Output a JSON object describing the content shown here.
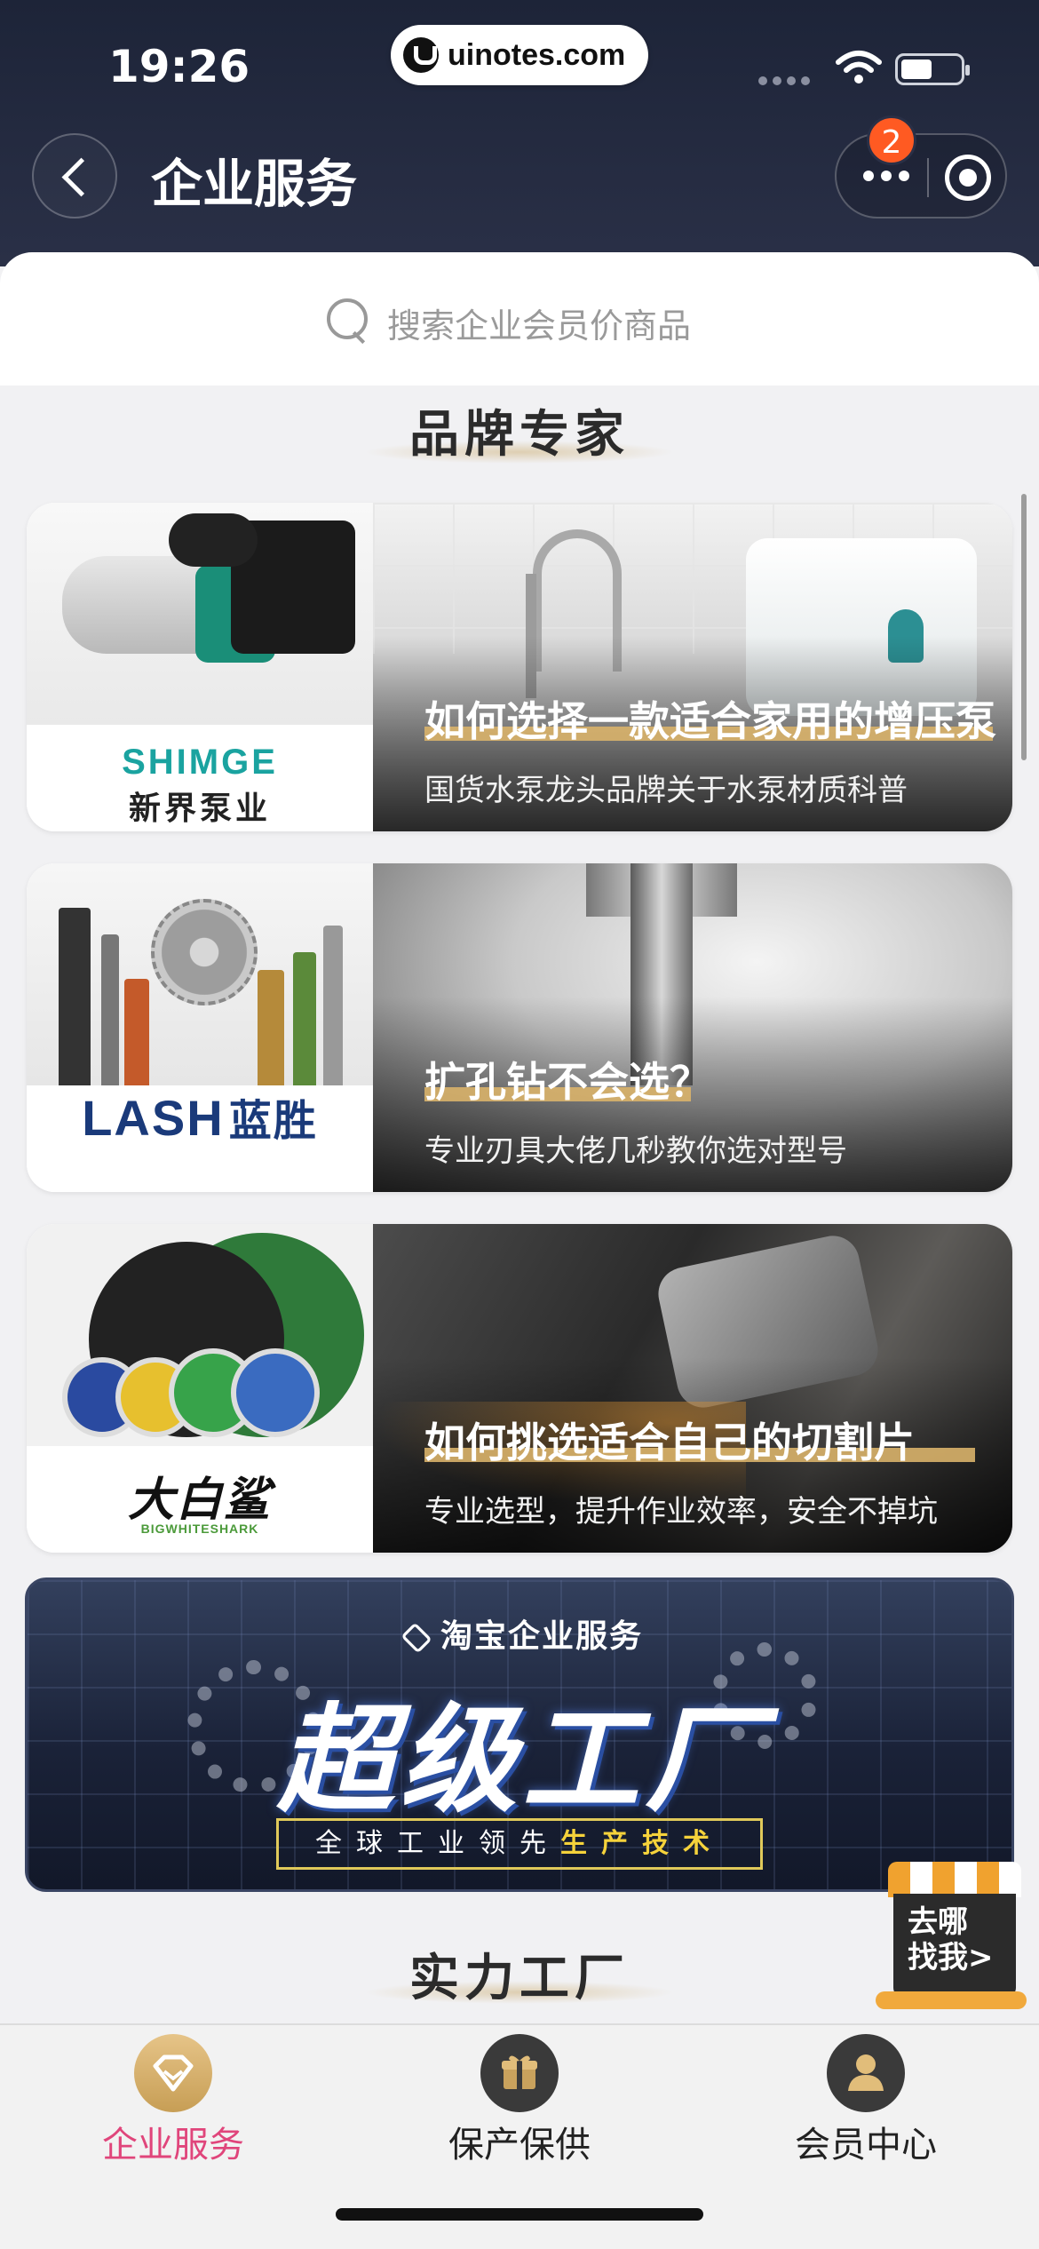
{
  "status_bar": {
    "time": "19:26",
    "watermark": "uinotes.com"
  },
  "nav": {
    "title": "企业服务",
    "badge_count": "2"
  },
  "search": {
    "placeholder": "搜索企业会员价商品"
  },
  "sections": {
    "brand_experts": "品牌专家",
    "strong_factory": "实力工厂"
  },
  "brand_cards": [
    {
      "brand_en": "SHIMGE",
      "brand_cn": "新界泵业",
      "title": "如何选择一款适合家用的增压泵",
      "subtitle": "国货水泵龙头品牌关于水泵材质科普"
    },
    {
      "brand_en": "LASH",
      "brand_cn": "蓝胜",
      "title": "扩孔钻不会选？",
      "subtitle": "专业刃具大佬几秒教你选对型号"
    },
    {
      "brand_cn": "大白鲨",
      "brand_en": "BIGWHITESHARK",
      "title": "如何挑选适合自己的切割片",
      "subtitle": "专业选型，提升作业效率，安全不掉坑"
    }
  ],
  "factory_banner": {
    "brand": "淘宝企业服务",
    "title": "超级工厂",
    "tagline_a": "全球工业领先",
    "tagline_b": "生产技术"
  },
  "float_shop": {
    "label_line1": "去哪",
    "label_line2": "找我>"
  },
  "tabbar": {
    "items": [
      {
        "label": "企业服务",
        "icon": "diamond-icon",
        "active": true
      },
      {
        "label": "保产保供",
        "icon": "gift-icon",
        "active": false
      },
      {
        "label": "会员中心",
        "icon": "user-icon",
        "active": false
      }
    ]
  },
  "colors": {
    "header_bg": "#1d2438",
    "accent_pink": "#e0457b",
    "gold": "#d9b36a",
    "badge": "#ff5a22"
  }
}
